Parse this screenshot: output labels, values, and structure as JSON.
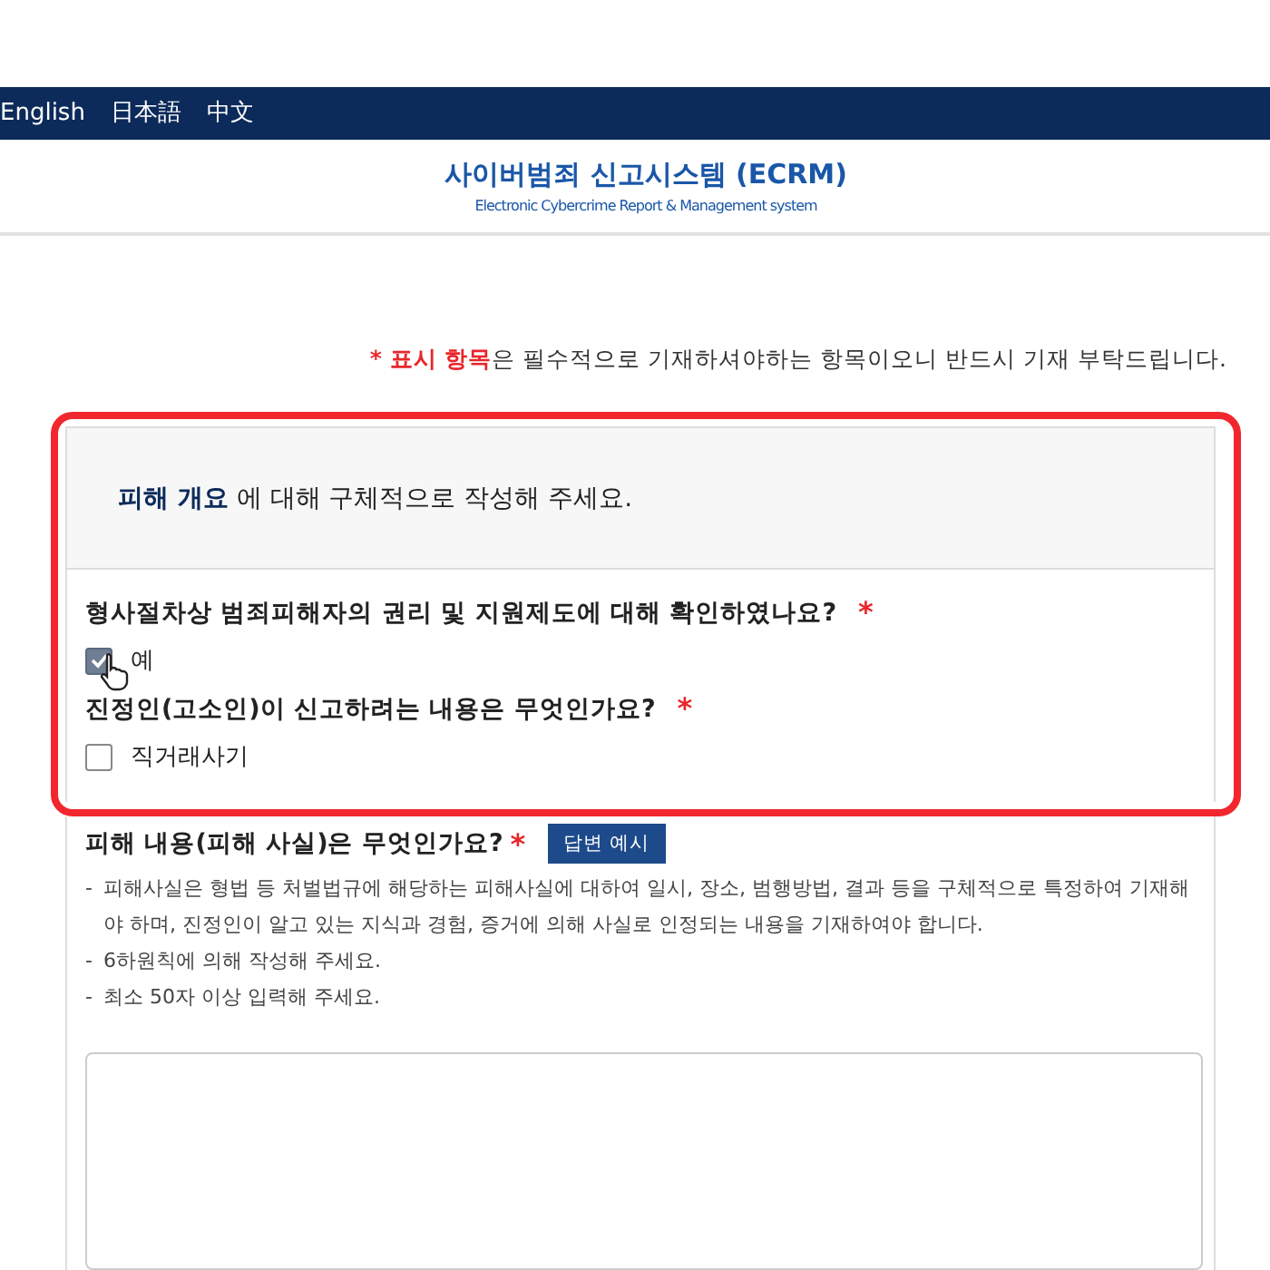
{
  "nav": {
    "languages": [
      "English",
      "日本語",
      "中文"
    ]
  },
  "header": {
    "title": "사이버범죄 신고시스템 (ECRM)",
    "subtitle": "Electronic Cybercrime Report & Management system"
  },
  "required_note": {
    "marker": "*",
    "highlight": "표시 항목",
    "text": "은 필수적으로 기재하셔야하는 항목이오니 반드시 기재 부탁드립니다."
  },
  "overview": {
    "highlighted": true,
    "title_highlight": "피해 개요",
    "title_rest": "에 대해 구체적으로 작성해 주세요.",
    "questions": [
      {
        "label": "형사절차상 범죄피해자의 권리 및 지원제도에 대해 확인하였나요?",
        "required": true,
        "options": [
          {
            "label": "예",
            "checked": true
          }
        ]
      },
      {
        "label": "진정인(고소인)이 신고하려는 내용은 무엇인가요?",
        "required": true,
        "options": [
          {
            "label": "직거래사기",
            "checked": false
          }
        ]
      }
    ]
  },
  "damage": {
    "label": "피해 내용(피해 사실)은 무엇인가요?",
    "required": true,
    "button": "답변 예시",
    "bullet": "-",
    "notes": [
      "피해사실은 형법 등 처벌법규에 해당하는 피해사실에 대하여 일시, 장소, 범행방법, 결과 등을 구체적으로 특정하여 기재해야 하며, 진정인이 알고 있는 지식과 경험, 증거에 의해 사실로 인정되는 내용을 기재하여야 합니다.",
      "6하원칙에 의해 작성해 주세요.",
      "최소 50자 이상 입력해 주세요."
    ]
  }
}
